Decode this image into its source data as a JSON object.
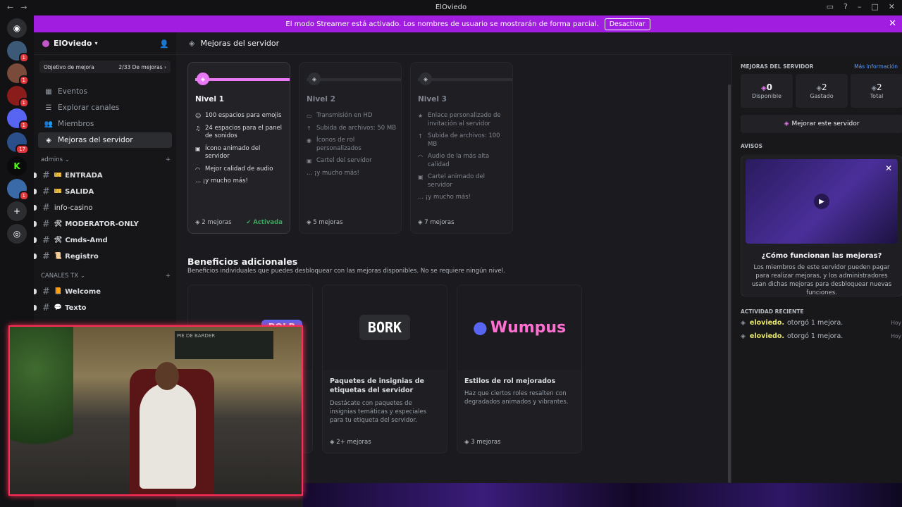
{
  "window": {
    "title": "ElOviedo"
  },
  "banner": {
    "text": "El modo Streamer está activado. Los nombres de usuario se mostrarán de forma parcial.",
    "button": "Desactivar"
  },
  "rail": {
    "badges": [
      "1",
      "1",
      "1",
      "1",
      "17",
      "1",
      "1"
    ]
  },
  "sidebar": {
    "server_name": "ElOviedo",
    "goal_label": "Objetivo de mejora",
    "goal_value": "2/33 De mejoras",
    "items": [
      {
        "label": "Eventos"
      },
      {
        "label": "Explorar canales"
      },
      {
        "label": "Miembros"
      },
      {
        "label": "Mejoras del servidor"
      }
    ],
    "categories": [
      {
        "name": "admins",
        "channels": [
          {
            "emoji": "🎫",
            "name": "ENTRADA"
          },
          {
            "emoji": "🎫",
            "name": "SALIDA"
          },
          {
            "emoji": "",
            "name": "info-casino"
          },
          {
            "emoji": "🛠",
            "name": "MODERATOR-ONLY"
          },
          {
            "emoji": "🛠",
            "name": "Cmds-Amd"
          },
          {
            "emoji": "📜",
            "name": "Registro"
          }
        ]
      },
      {
        "name": "CANALES TX",
        "channels": [
          {
            "emoji": "📙",
            "name": "Welcome"
          },
          {
            "emoji": "💬",
            "name": "Texto"
          }
        ]
      }
    ]
  },
  "main": {
    "header": "Mejoras del servidor",
    "tiers": [
      {
        "name": "Nivel 1",
        "perks": [
          "100 espacios para emojis",
          "24 espacios para el panel de sonidos",
          "Ícono animado del servidor",
          "Mejor calidad de audio"
        ],
        "more": "... ¡y mucho más!",
        "count": "2 mejoras",
        "status": "Activada"
      },
      {
        "name": "Nivel 2",
        "perks": [
          "Transmisión en HD",
          "Subida de archivos: 50 MB",
          "Íconos de rol personalizados",
          "Cartel del servidor"
        ],
        "more": "... ¡y mucho más!",
        "count": "5 mejoras",
        "status": ""
      },
      {
        "name": "Nivel 3",
        "perks": [
          "Enlace personalizado de invitación al servidor",
          "Subida de archivos: 100 MB",
          "Audio de la más alta calidad",
          "Cartel animado del servidor"
        ],
        "more": "... ¡y mucho más!",
        "count": "7 mejoras",
        "status": ""
      }
    ],
    "extra_title": "Beneficios adicionales",
    "extra_sub": "Beneficios individuales que puedes desbloquear con las mejoras disponibles. No se requiere ningún nivel.",
    "perks": [
      {
        "logo": "POLR",
        "title": "",
        "desc": "",
        "count": ""
      },
      {
        "logo": "BORK",
        "title": "Paquetes de insignias de etiquetas del servidor",
        "desc": "Destácate con paquetes de insignias temáticas y especiales para tu etiqueta del servidor.",
        "count": "2+ mejoras"
      },
      {
        "logo": "Wumpus",
        "title": "Estilos de rol mejorados",
        "desc": "Haz que ciertos roles resalten con degradados animados y vibrantes.",
        "count": "3 mejoras"
      }
    ]
  },
  "right": {
    "title": "MEJORAS DEL SERVIDOR",
    "more_info": "Más información",
    "stats": [
      {
        "value": "0",
        "label": "Disponible"
      },
      {
        "value": "2",
        "label": "Gastado"
      },
      {
        "value": "2",
        "label": "Total"
      }
    ],
    "boost_button": "Mejorar este servidor",
    "notices_title": "AVISOS",
    "notice_title": "¿Cómo funcionan las mejoras?",
    "notice_desc": "Los miembros de este servidor pueden pagar para realizar mejoras, y los administradores usan dichas mejoras para desbloquear nuevas funciones.",
    "activity_title": "ACTIVIDAD RECIENTE",
    "activity": [
      {
        "user": "eloviedo.",
        "text": "otorgó 1 mejora.",
        "when": "Hoy"
      },
      {
        "user": "eloviedo.",
        "text": "otorgó 1 mejora.",
        "when": "Hoy"
      }
    ]
  },
  "camera": {
    "tv_text": "PIE DE BARDER"
  },
  "colors": {
    "accent": "#a11ee0",
    "boost_pink": "#e978f5",
    "active_green": "#3ba55d",
    "cam_border": "#ff2d55"
  }
}
